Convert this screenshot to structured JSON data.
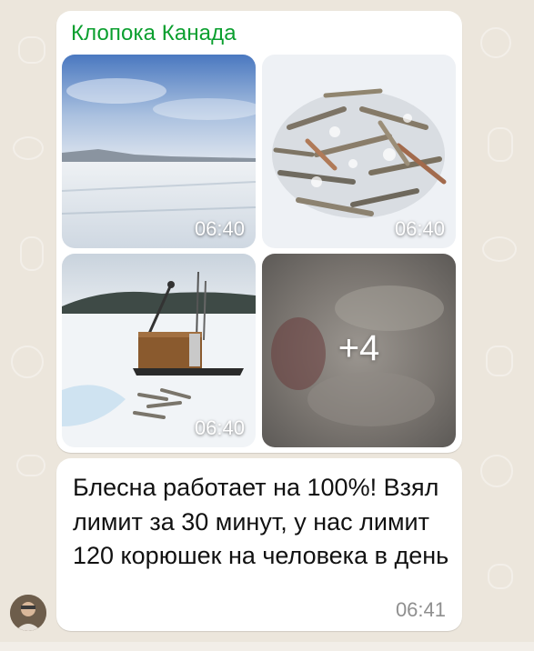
{
  "chat": {
    "sender_name": "Клопока Канада",
    "media_group": {
      "tiles": [
        {
          "name": "frozen-lake-photo",
          "time": "06:40"
        },
        {
          "name": "caught-fish-photo",
          "time": "06:40"
        },
        {
          "name": "fishing-sled-photo",
          "time": "06:40"
        },
        {
          "name": "more-photos-tile",
          "more_label": "+4"
        }
      ]
    },
    "text_message": {
      "text": "Блесна работает на 100%! Взял лимит за 30 минут, у нас лимит 120 корюшек на человека в день",
      "time": "06:41"
    }
  },
  "colors": {
    "sender_name": "#0b9f2f",
    "wallpaper": "#ece6dc",
    "bubble": "#ffffff",
    "timestamp": "#8f8f8f"
  }
}
